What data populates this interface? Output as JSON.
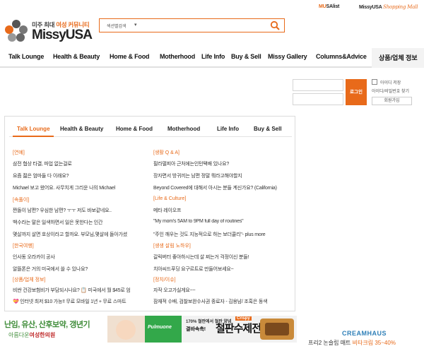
{
  "header": {
    "musa_prefix": "MU",
    "musa_suffix": "SAlist",
    "shop_brand": "MissyUSA",
    "shop_label": "Shopping Mall",
    "logo_tagline_pre": "미주 최대 ",
    "logo_tagline_accent": "여성 커뮤니티",
    "logo_name": "MissyUSA",
    "search_scope": "섹션별검색",
    "search_dropdown_arrow": "▾"
  },
  "nav": {
    "items": [
      "Talk Lounge",
      "Health & Beauty",
      "Home & Food",
      "Motherhood",
      "Life Info",
      "Buy & Sell",
      "Missy Gallery",
      "Columns&Advice"
    ],
    "category": "상품/업체 정보"
  },
  "login": {
    "button": "로그인",
    "save_id": "아이디 저장",
    "find": "아이디/비밀번호 찾기",
    "join": "회원가입"
  },
  "board": {
    "tabs": [
      "Talk Lounge",
      "Health & Beauty",
      "Home & Food",
      "Motherhood",
      "Life Info",
      "Buy & Sell"
    ],
    "left": [
      {
        "section": "[연예]",
        "lines": [
          "삼전 협상 타결, 파업 없는걸로",
          "요즘 젊은 엄마들 다 이래요?",
          "Michael 보고 왔어요. 사무치게 그리운 나의 Michael"
        ]
      },
      {
        "section": "[속풀이]",
        "lines": [
          "짠돌이 남편? 우심한 남편? ㅜㅜ 저도 바보같네요..",
          "백수라는 말은 일색하면서 일은 못한다는 인간",
          "몇살까지 살면 호상이라고 할까요. 부모님,몇살에 돌아가셨"
        ]
      },
      {
        "section": "[한국여행]",
        "lines": [
          "인사동 오라카이 공사",
          "알뜰폰은 거의 미국에서 쓸 수 있나요?"
        ]
      },
      {
        "section": "[상품/업체 정보]",
        "lines": [
          "비싼 건강보험비가 부담되시나요? 📋 미국에서 월 $45로 엄",
          "💝 인터넷 최저 $10 가능!! 무료 모바일 1년 + 무료 스마트"
        ]
      }
    ],
    "right": [
      {
        "section": "[생활 Q & A]",
        "lines": [
          "필라델피아 근처에는인턴택배 있나요?",
          "장자면서 방귀끼는 남편 정말 뭐라고해야할지",
          "Beyond Covered에 대해서 아시는 분들 계신가요? (California)"
        ]
      },
      {
        "section": "[Life & Culture]",
        "lines": [
          "메타 레이오프",
          "\"My mom's 5AM to 9PM full day of routines\"",
          "\"주인 깨우는 것도 지능적으로 하는 보더콜리\"- plus more"
        ]
      },
      {
        "section": "[생생 살림 노하우]",
        "lines": [
          "갈릭버터 좋아하시는데 살 찌는거 걱정이신 분들!",
          "치아씨드푸딩 요구르트로 만들어보세요~"
        ]
      },
      {
        "section": "[정치/이슈]",
        "lines": [
          "자작 오고가실게요~~",
          "잠재적 수배, 검찰보완수사권 종료자 - 김용남/ 조혹은 동색"
        ]
      }
    ]
  },
  "ads": {
    "ad1_title": "난임, 유산, 산후보약, 갱년기",
    "ad1_prefix": "아름다운",
    "ad1_clinic": "여성한의원",
    "ad2_brand": "Pulmuone",
    "ad2_promo1": "170% 철판에서 철판 양념",
    "ad2_promo2": "결바속촉!",
    "ad2_big": "철판수제전",
    "ad2_tag": "Crispy",
    "ad3_brand": "CREAMHAUS",
    "ad3_line_pre": "프리2 논슬립 매트",
    "ad3_line_accent": "비타크림",
    "ad3_line_discount": "35~40%"
  },
  "colors": {
    "accent": "#e86a1a",
    "green": "#3d8b37"
  }
}
